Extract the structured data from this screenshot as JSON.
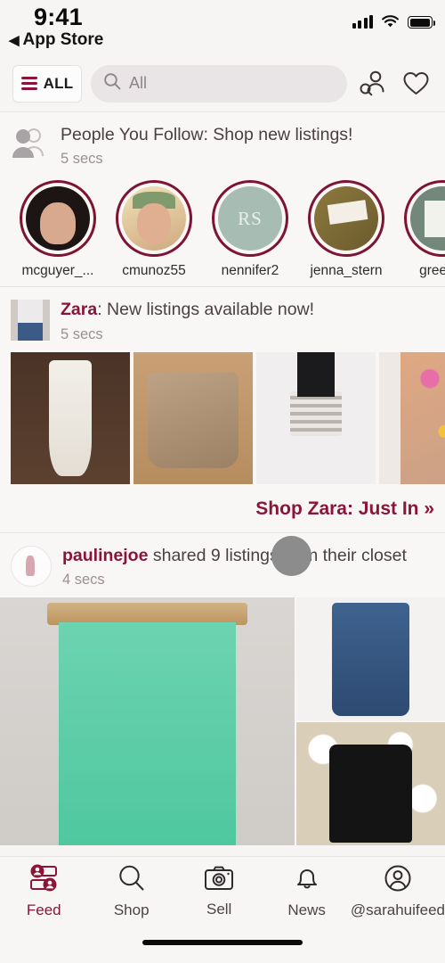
{
  "status_bar": {
    "time": "9:41",
    "back_label": "App Store",
    "back_glyph": "◀",
    "icons": [
      "cellular-signal-icon",
      "wifi-icon",
      "battery-icon"
    ]
  },
  "header": {
    "category_button": "ALL",
    "search_placeholder": "All",
    "search_value": "",
    "icons": [
      "hamburger-icon",
      "search-icon",
      "find-people-icon",
      "heart-icon"
    ]
  },
  "feed": {
    "people_you_follow": {
      "title": "People You Follow: Shop new listings!",
      "time": "5 secs",
      "avatar_icon": "people-group-icon",
      "users": [
        {
          "name": "mcguyer_...",
          "fill": "f-av1"
        },
        {
          "name": "cmunoz55",
          "fill": "f-av2"
        },
        {
          "name": "nennifer2",
          "fill": "f-av3",
          "initials": "RS"
        },
        {
          "name": "jenna_stern",
          "fill": "f-av4"
        },
        {
          "name": "greenla",
          "fill": "f-av5"
        }
      ]
    },
    "brand_post": {
      "brand": "Zara",
      "title_rest": ": New listings available now!",
      "time": "5 secs",
      "thumb_fill": "f-zaraav",
      "photos": [
        {
          "alt": "white-jeans-listing",
          "fill": "f-whitepants"
        },
        {
          "alt": "tan-skirt-listing",
          "fill": "f-tanskirt"
        },
        {
          "alt": "ruffle-mini-skirt-listing",
          "fill": "f-ruffle"
        },
        {
          "alt": "floral-dress-listing",
          "fill": "f-floral"
        }
      ],
      "shop_link": "Shop Zara: Just In »"
    },
    "user_post": {
      "username": "paulinejoe",
      "action": " shared 9 listings from their closet",
      "time": "4 secs",
      "thumb_fill": "f-paulav",
      "photos": [
        {
          "alt": "mint-pencil-skirt-listing",
          "fill": "f-mint"
        },
        {
          "alt": "blue-jeans-listing",
          "fill": "f-jeans"
        },
        {
          "alt": "black-ankle-boot-listing",
          "fill": "f-boot"
        }
      ]
    }
  },
  "tab_bar": {
    "items": [
      {
        "label": "Feed",
        "icon": "feed-icon",
        "active": true
      },
      {
        "label": "Shop",
        "icon": "search-icon",
        "active": false
      },
      {
        "label": "Sell",
        "icon": "camera-icon",
        "active": false
      },
      {
        "label": "News",
        "icon": "bell-icon",
        "active": false
      },
      {
        "label": "@sarahuifeed",
        "icon": "profile-icon",
        "active": false
      }
    ]
  },
  "colors": {
    "brand_maroon": "#8a1538",
    "avatar_ring": "#7d1433",
    "background": "#f7f4f4",
    "text": "#4a4043",
    "muted_text": "#9a9094",
    "search_field": "#e9e5e6"
  },
  "overlay": {
    "loader": "loading-spinner-circle"
  }
}
